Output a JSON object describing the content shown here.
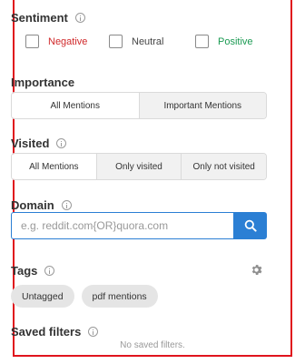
{
  "sentiment": {
    "title": "Sentiment",
    "options": [
      {
        "label": "Negative",
        "checked": false,
        "color": "#d0282a"
      },
      {
        "label": "Neutral",
        "checked": false,
        "color": "#444444"
      },
      {
        "label": "Positive",
        "checked": false,
        "color": "#1a9a52"
      }
    ]
  },
  "importance": {
    "title": "Importance",
    "options": [
      "All Mentions",
      "Important Mentions"
    ],
    "selected": "All Mentions"
  },
  "visited": {
    "title": "Visited",
    "options": [
      "All Mentions",
      "Only visited",
      "Only not visited"
    ],
    "selected": "All Mentions"
  },
  "domain": {
    "title": "Domain",
    "placeholder": "e.g. reddit.com{OR}quora.com",
    "value": "",
    "button_icon": "search-icon"
  },
  "tags": {
    "title": "Tags",
    "settings_icon": "gear-icon",
    "items": [
      "Untagged",
      "pdf mentions"
    ]
  },
  "saved_filters": {
    "title": "Saved filters",
    "empty_text": "No saved filters."
  },
  "colors": {
    "accent": "#2b7fd4",
    "highlight_border": "#e0141d"
  }
}
